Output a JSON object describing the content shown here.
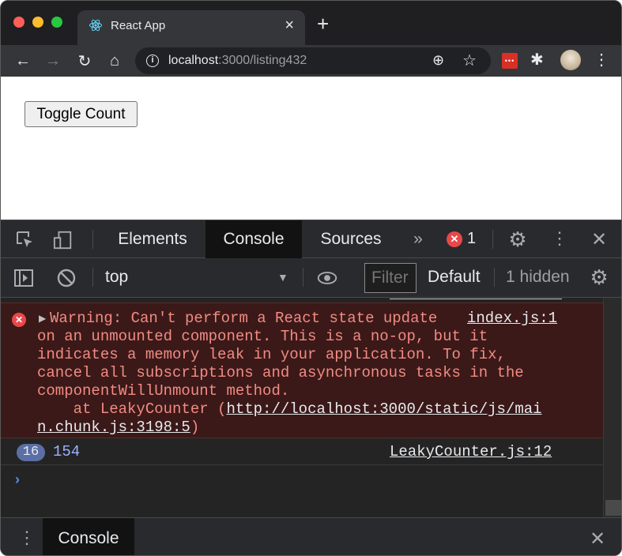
{
  "browser": {
    "tab": {
      "title": "React App",
      "favicon": "react-logo-icon"
    },
    "new_tab_label": "+",
    "url": {
      "host": "localhost",
      "rest": ":3000/listing432"
    }
  },
  "page": {
    "toggle_button": "Toggle Count"
  },
  "devtools": {
    "tabs": [
      "Elements",
      "Console",
      "Sources"
    ],
    "more_tabs": "»",
    "error_badge": "✕",
    "error_count": "1",
    "context": "top",
    "filter_placeholder": "Filter",
    "levels": "Default",
    "hidden": "1 hidden",
    "error": {
      "line1": "Warning: Can't perform a React state update ",
      "line1_link": "index.js:1",
      "line2": "on an unmounted component. This is a no-op, but it",
      "line3": "indicates a memory leak in your application. To fix,",
      "line4": "cancel all subscriptions and asynchronous tasks in the",
      "line5": "componentWillUnmount method.",
      "line6_prefix": "    at LeakyCounter (",
      "line6_link": "http://localhost:3000/static/js/mai",
      "line7_link": "n.chunk.js:3198:5",
      "line7_suffix": ")"
    },
    "log": {
      "repeat": "16",
      "value": "154",
      "source": "LeakyCounter.js:12"
    },
    "prompt": "›",
    "drawer_tab": "Console"
  },
  "colors": {
    "error_bg": "#3b1919",
    "error_text": "#f28b82",
    "accent_blue": "#9cb2ff"
  }
}
